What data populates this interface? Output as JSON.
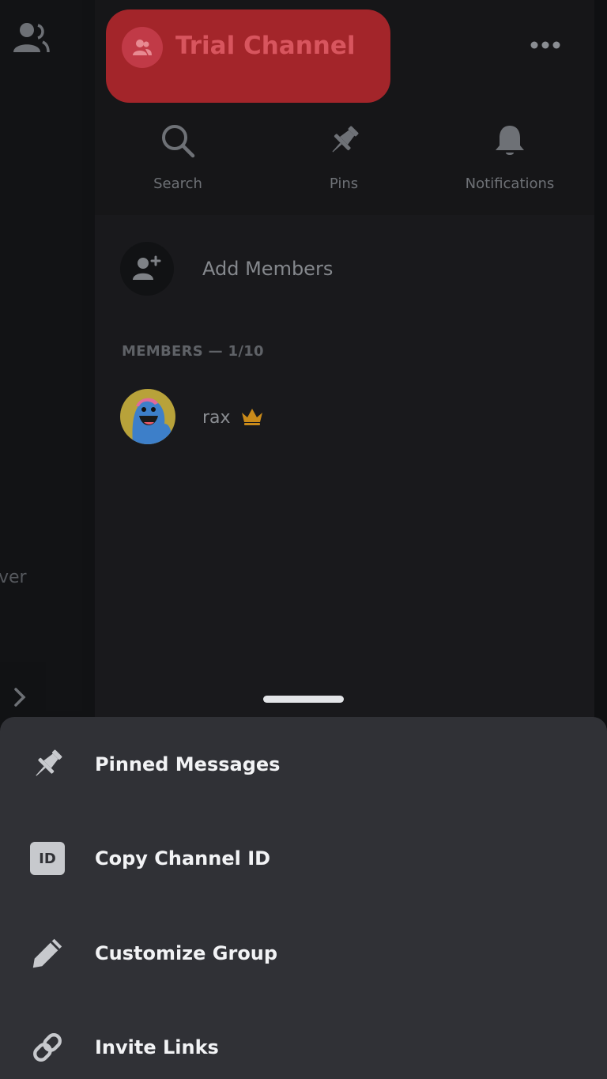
{
  "sidebar": {
    "partial_text": "ver"
  },
  "channel": {
    "title": "Trial Channel"
  },
  "actions": [
    {
      "label": "Search",
      "icon": "search-icon"
    },
    {
      "label": "Pins",
      "icon": "pin-icon"
    },
    {
      "label": "Notifications",
      "icon": "bell-icon"
    }
  ],
  "add_members": {
    "label": "Add Members"
  },
  "members": {
    "header": "MEMBERS — 1/10",
    "list": [
      {
        "name": "rax",
        "badge": "crown-icon"
      }
    ]
  },
  "sheet": {
    "items": [
      {
        "label": "Pinned Messages",
        "icon": "pin-icon"
      },
      {
        "label": "Copy Channel ID",
        "icon": "id-icon",
        "icon_text": "ID"
      },
      {
        "label": "Customize Group",
        "icon": "pencil-icon"
      },
      {
        "label": "Invite Links",
        "icon": "link-icon"
      }
    ]
  },
  "colors": {
    "channel_pill": "#a3252a",
    "sheet_bg": "#303136",
    "crown": "#c98a1a"
  }
}
